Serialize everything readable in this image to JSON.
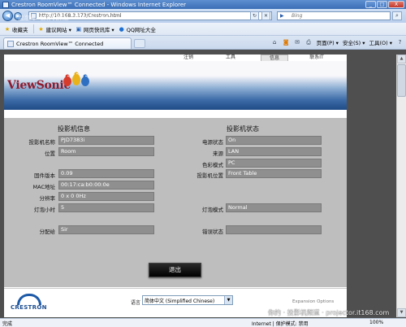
{
  "window": {
    "title": "Crestron RoomView™ Connected - Windows Internet Explorer",
    "controls": [
      "_",
      "□",
      "X"
    ]
  },
  "address": {
    "url": "http://10.168.3.173/Crestron.html",
    "search_placeholder": "Bing",
    "search_engine": "Bing"
  },
  "favorites": {
    "items": [
      {
        "label": "收藏夹",
        "icon": "star-icon"
      },
      {
        "label": "建议网站 ▾",
        "icon": "star-icon"
      },
      {
        "label": "网页快讯库 ▾",
        "icon": "page-icon"
      },
      {
        "label": "QQ网址大全",
        "icon": "qq-icon"
      }
    ]
  },
  "tabs": [
    {
      "label": "Crestron RoomView™ Connected"
    }
  ],
  "commandbar": {
    "page": "页面(P) ▾",
    "safety": "安全(S) ▾",
    "tools": "工具(O) ▾"
  },
  "page": {
    "nav": [
      "注销",
      "工具",
      "信息",
      "联系IT"
    ],
    "active_nav": "信息",
    "brand": "ViewSonic",
    "projector_info": {
      "title": "投影机信息",
      "fields": [
        {
          "label": "投影机名称",
          "value": "PJD7383i"
        },
        {
          "label": "位置",
          "value": "Room"
        },
        {
          "label": "固件版本",
          "value": "0.09"
        },
        {
          "label": "MAC地址",
          "value": "00:17:ca:b0:00:0e"
        },
        {
          "label": "分辨率",
          "value": "0 x 0 0Hz"
        },
        {
          "label": "灯泡小时",
          "value": "5"
        },
        {
          "label": "分配给",
          "value": "Sir"
        }
      ]
    },
    "projector_status": {
      "title": "投影机状态",
      "fields": [
        {
          "label": "电源状态",
          "value": "On"
        },
        {
          "label": "来源",
          "value": "LAN"
        },
        {
          "label": "色彩模式",
          "value": "PC"
        },
        {
          "label": "投影机位置",
          "value": "Front Table"
        },
        {
          "label": "灯泡模式",
          "value": "Normal"
        },
        {
          "label": "错误状态",
          "value": ""
        }
      ]
    },
    "exit_label": "退出",
    "footer": {
      "brand": "CRESTRON",
      "language_label": "语言",
      "language_value": "简体中文 (Simplified Chinese)",
      "expansion": "Expansion Options"
    }
  },
  "status": {
    "text": "完成",
    "zone": "Internet | 保护模式: 禁用",
    "zoom": "100%"
  },
  "watermarks": {
    "top": "泡泡网 · 投影机频道 · PCPOP.COM",
    "bottom": "你的 · 投影机频道 · projector.it168.com"
  },
  "colors": {
    "panel": "#bebebe",
    "field": "#8f8f8f",
    "brand_red": "#8e1a2d",
    "header_blue": "#1f4b86"
  }
}
